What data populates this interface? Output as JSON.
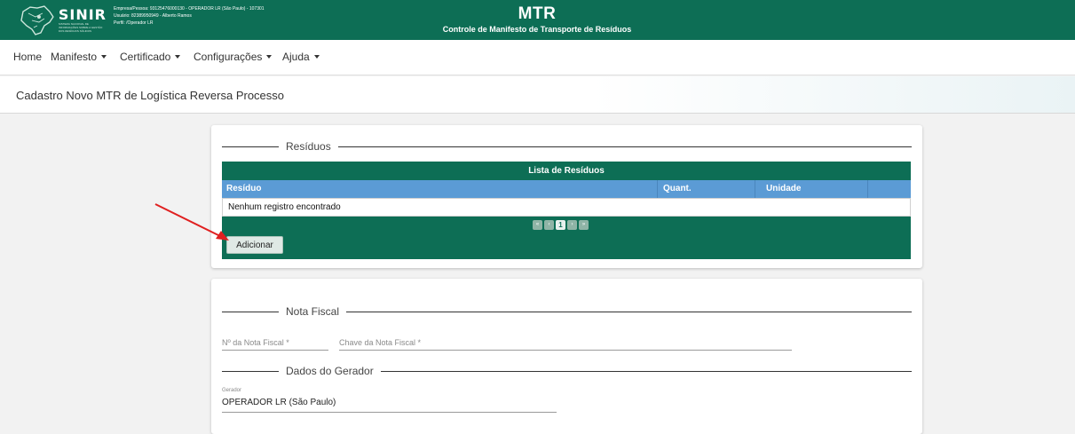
{
  "header": {
    "logo_name": "SINIR",
    "logo_sub": "SISTEMA NACIONAL DE INFORMAÇÕES SOBRE A GESTÃO DOS RESÍDUOS SÓLIDOS",
    "empresa": "Empresa/Pessoa: 93125476000130 - OPERADOR LR (São Paulo) - 107301",
    "usuario": "Usuário: 82389950949 - Alberto Ramos",
    "perfil": "Perfil: /Operador LR",
    "app_title": "MTR",
    "app_subtitle": "Controle de Manifesto de Transporte de Resíduos"
  },
  "menu": {
    "items": [
      {
        "label": "Home"
      },
      {
        "label": "Manifesto"
      },
      {
        "label": "Certificado"
      },
      {
        "label": "Configurações"
      },
      {
        "label": "Ajuda"
      }
    ]
  },
  "page": {
    "title": "Cadastro Novo MTR de Logística Reversa Processo"
  },
  "residuos": {
    "legend": "Resíduos",
    "grid_caption": "Lista de Resíduos",
    "columns": [
      "Resíduo",
      "Quant.",
      "Unidade"
    ],
    "empty_message": "Nenhum registro encontrado",
    "current_page": "1",
    "add_label": "Adicionar"
  },
  "nota_fiscal": {
    "legend": "Nota Fiscal",
    "numero_placeholder": "Nº da Nota Fiscal *",
    "chave_placeholder": "Chave da Nota Fiscal *"
  },
  "gerador": {
    "legend": "Dados do Gerador",
    "label": "Gerador",
    "value": "OPERADOR LR (São Paulo)"
  },
  "colors": {
    "brand": "#0d6e55",
    "grid_header": "#5b9bd5",
    "annotation_arrow": "#e02020"
  }
}
